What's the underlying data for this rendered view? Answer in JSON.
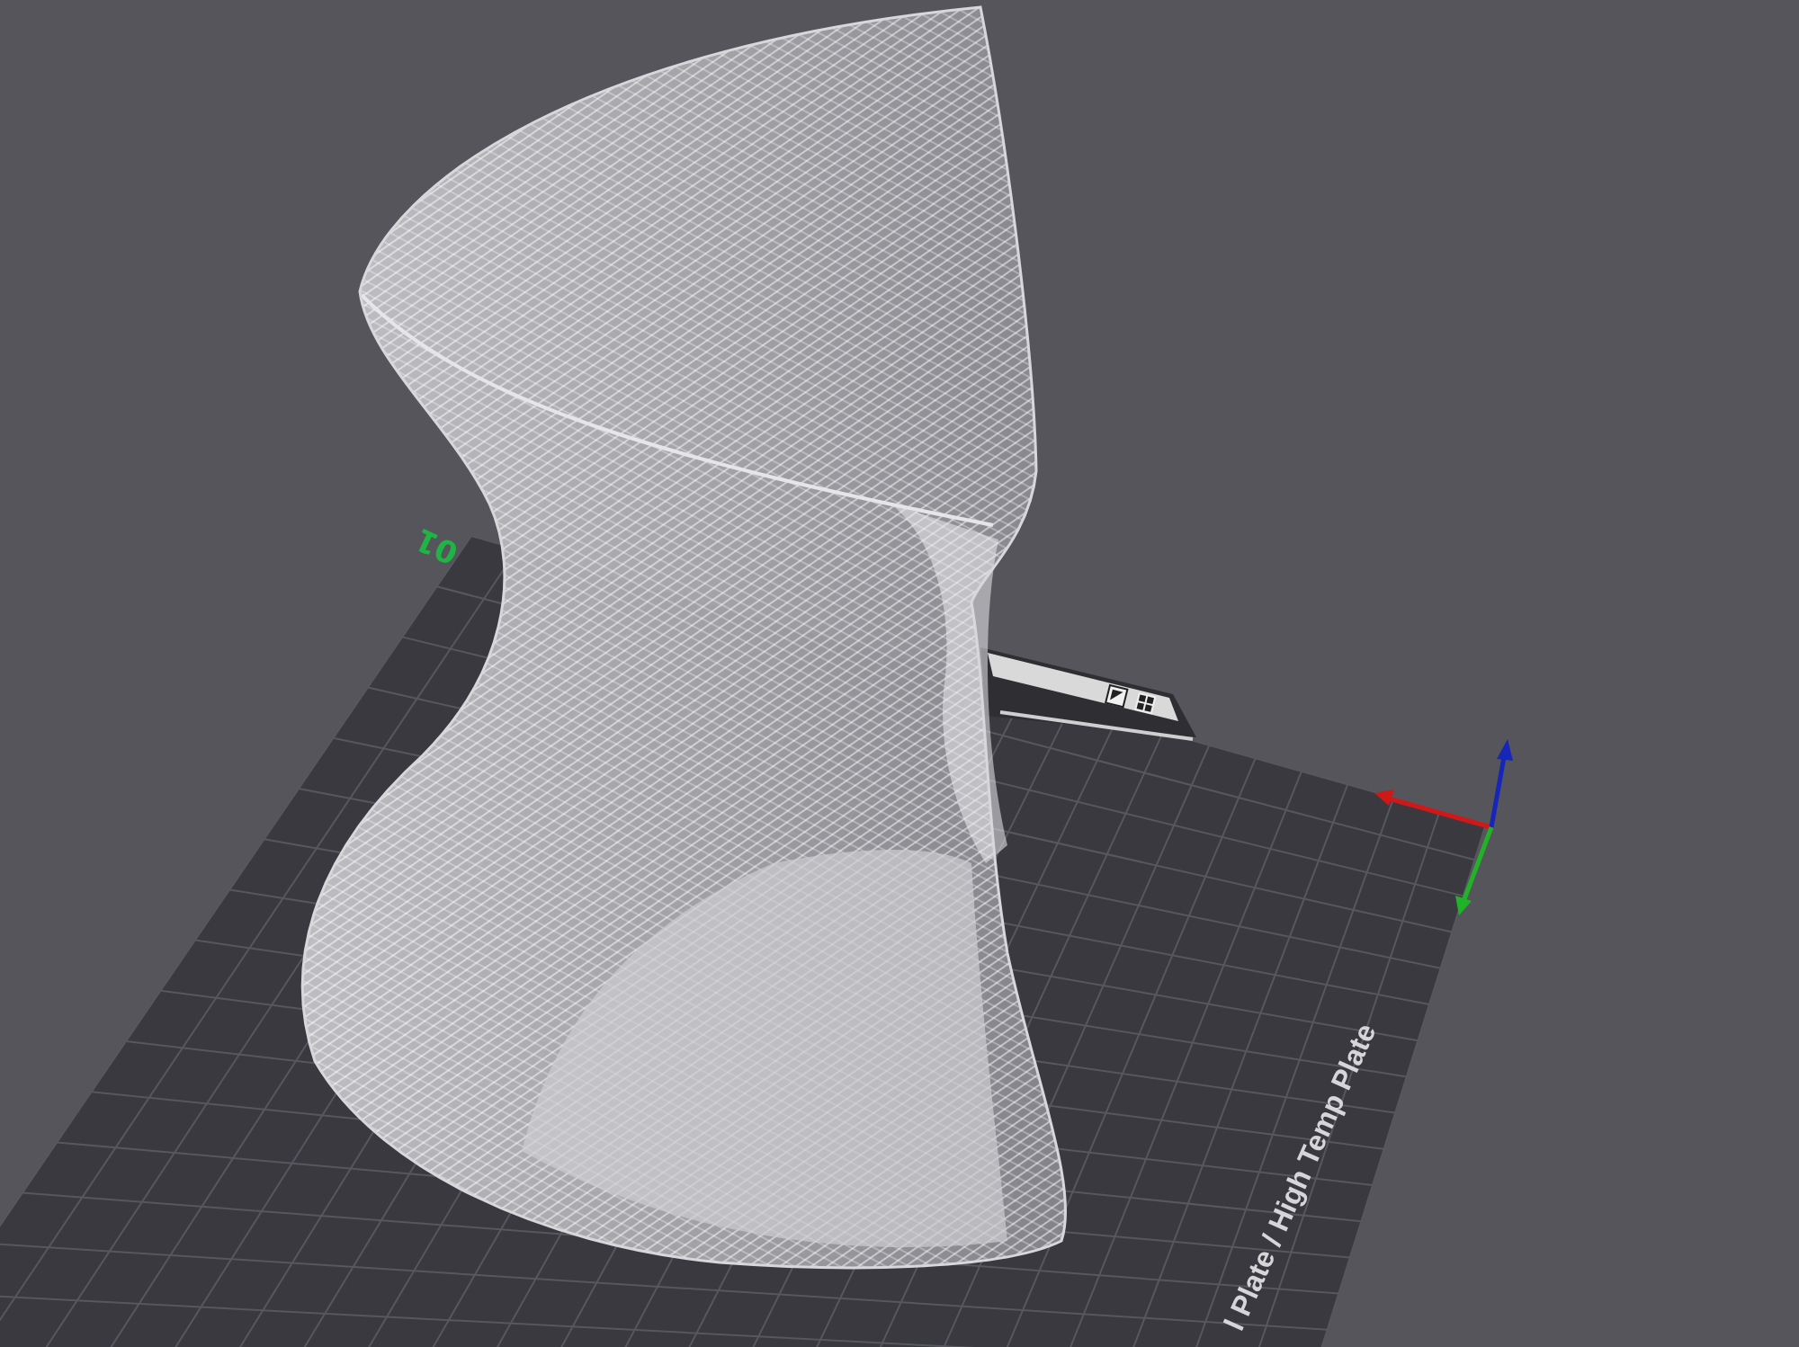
{
  "viewport": {
    "plate_number": "01",
    "plate_label": "l Plate / High Temp Plate"
  }
}
